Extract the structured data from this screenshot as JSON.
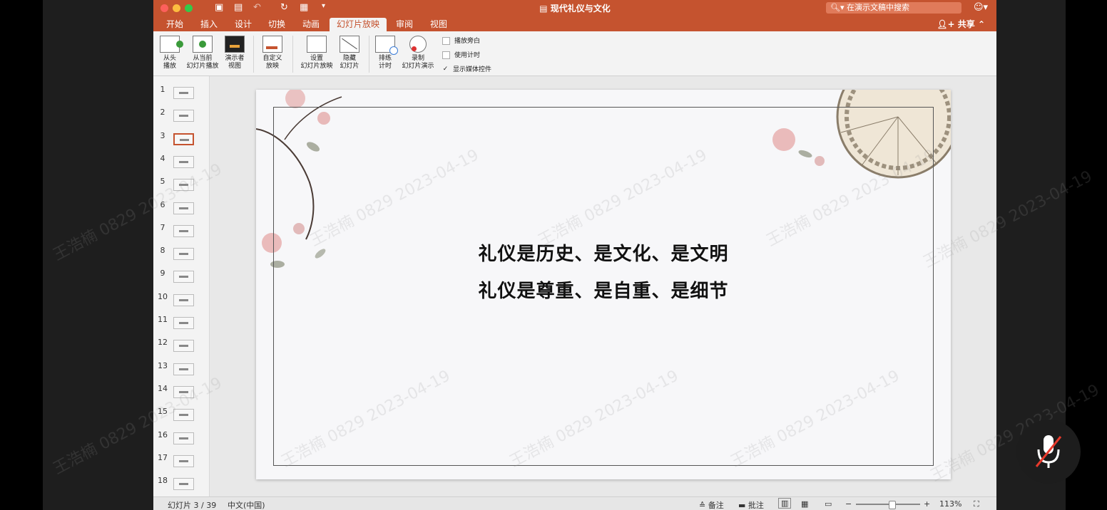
{
  "window": {
    "doc_title": "现代礼仪与文化",
    "search_placeholder": "在演示文稿中搜索",
    "share_label": "共享"
  },
  "tabs": [
    {
      "label": "开始"
    },
    {
      "label": "插入"
    },
    {
      "label": "设计"
    },
    {
      "label": "切换"
    },
    {
      "label": "动画"
    },
    {
      "label": "幻灯片放映"
    },
    {
      "label": "审阅"
    },
    {
      "label": "视图"
    }
  ],
  "ribbon": {
    "from_start": [
      "从头",
      "播放"
    ],
    "from_current": [
      "从当前",
      "幻灯片播放"
    ],
    "presenter_view": [
      "演示者",
      "视图"
    ],
    "custom_show": [
      "自定义",
      "放映"
    ],
    "setup_show": [
      "设置",
      "幻灯片放映"
    ],
    "hide_slide": [
      "隐藏",
      "幻灯片"
    ],
    "rehearse": [
      "排练",
      "计时"
    ],
    "record": [
      "录制",
      "幻灯片演示"
    ],
    "checks": [
      {
        "label": "播放旁白",
        "checked": false
      },
      {
        "label": "使用计时",
        "checked": false
      },
      {
        "label": "显示媒体控件",
        "checked": true
      }
    ]
  },
  "thumbnails": [
    "1",
    "2",
    "3",
    "4",
    "5",
    "6",
    "7",
    "8",
    "9",
    "10",
    "11",
    "12",
    "13",
    "14",
    "15",
    "16",
    "17",
    "18"
  ],
  "selected_slide": 3,
  "slide": {
    "line1": "礼仪是历史、是文化、是文明",
    "line2": "礼仪是尊重、是自重、是细节"
  },
  "status": {
    "slide_info": "幻灯片 3 / 39",
    "language": "中文(中国)",
    "notes": "备注",
    "comments": "批注",
    "zoom": "113%",
    "zoom_level": 0.55
  },
  "watermark": "王浩楠 0829 2023-04-19",
  "colors": {
    "accent": "#c5532f"
  }
}
